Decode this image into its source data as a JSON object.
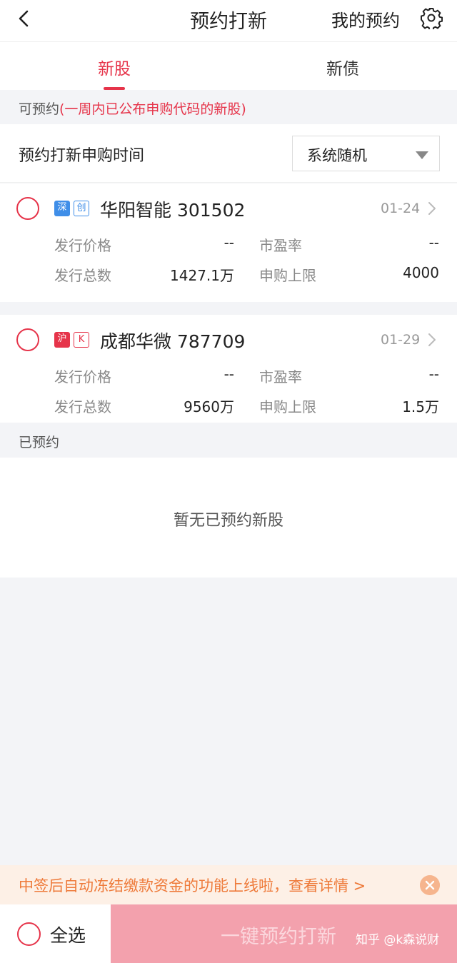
{
  "header": {
    "title": "预约打新",
    "my_reserve": "我的预约",
    "back_icon": "chevron-left-icon",
    "settings_icon": "gear-icon"
  },
  "tabs": [
    {
      "label": "新股",
      "active": true
    },
    {
      "label": "新债",
      "active": false
    }
  ],
  "available": {
    "label": "可预约",
    "note": "(一周内已公布申购代码的新股)"
  },
  "subscribe_time": {
    "label": "预约打新申购时间",
    "selected": "系统随机"
  },
  "stocks": [
    {
      "badge_market": "深",
      "badge_board": "创",
      "name": "华阳智能 301502",
      "date": "01-24",
      "issue_price_label": "发行价格",
      "issue_price": "--",
      "pe_label": "市盈率",
      "pe": "--",
      "issue_total_label": "发行总数",
      "issue_total": "1427.1万",
      "limit_label": "申购上限",
      "limit": "4000"
    },
    {
      "badge_market": "沪",
      "badge_board": "K",
      "name": "成都华微 787709",
      "date": "01-29",
      "issue_price_label": "发行价格",
      "issue_price": "--",
      "pe_label": "市盈率",
      "pe": "--",
      "issue_total_label": "发行总数",
      "issue_total": "9560万",
      "limit_label": "申购上限",
      "limit": "1.5万"
    }
  ],
  "reserved": {
    "label": "已预约",
    "empty_text": "暂无已预约新股"
  },
  "banner": {
    "text": "中签后自动冻结缴款资金的功能上线啦，查看详情 >"
  },
  "footer": {
    "select_all": "全选",
    "submit": "一键预约打新",
    "watermark": "知乎 @k森说财"
  },
  "colors": {
    "accent": "#e6344a",
    "submit_disabled": "#f3a1ad",
    "banner_text": "#ee7a3a"
  }
}
